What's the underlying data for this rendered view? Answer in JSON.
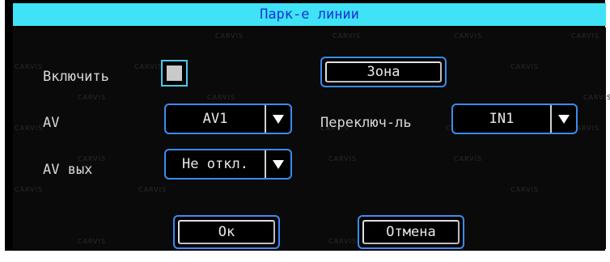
{
  "dialog": {
    "title": "Парк-е линии",
    "watermark": "CARVIS"
  },
  "form": {
    "enable_label": "Включить",
    "enable_checked": false,
    "zone_button": "Зона",
    "av_label": "AV",
    "av_value": "AV1",
    "switch_label": "Переключ-ль",
    "switch_value": "IN1",
    "av_out_label": "AV вых",
    "av_out_value": "Не откл."
  },
  "actions": {
    "ok": "Ок",
    "cancel": "Отмена"
  },
  "colors": {
    "title_bg": "#3fe3f5",
    "title_text": "#1a33d6",
    "focus_border": "#3a8cf0",
    "checkbox_border": "#4ec8e8"
  }
}
